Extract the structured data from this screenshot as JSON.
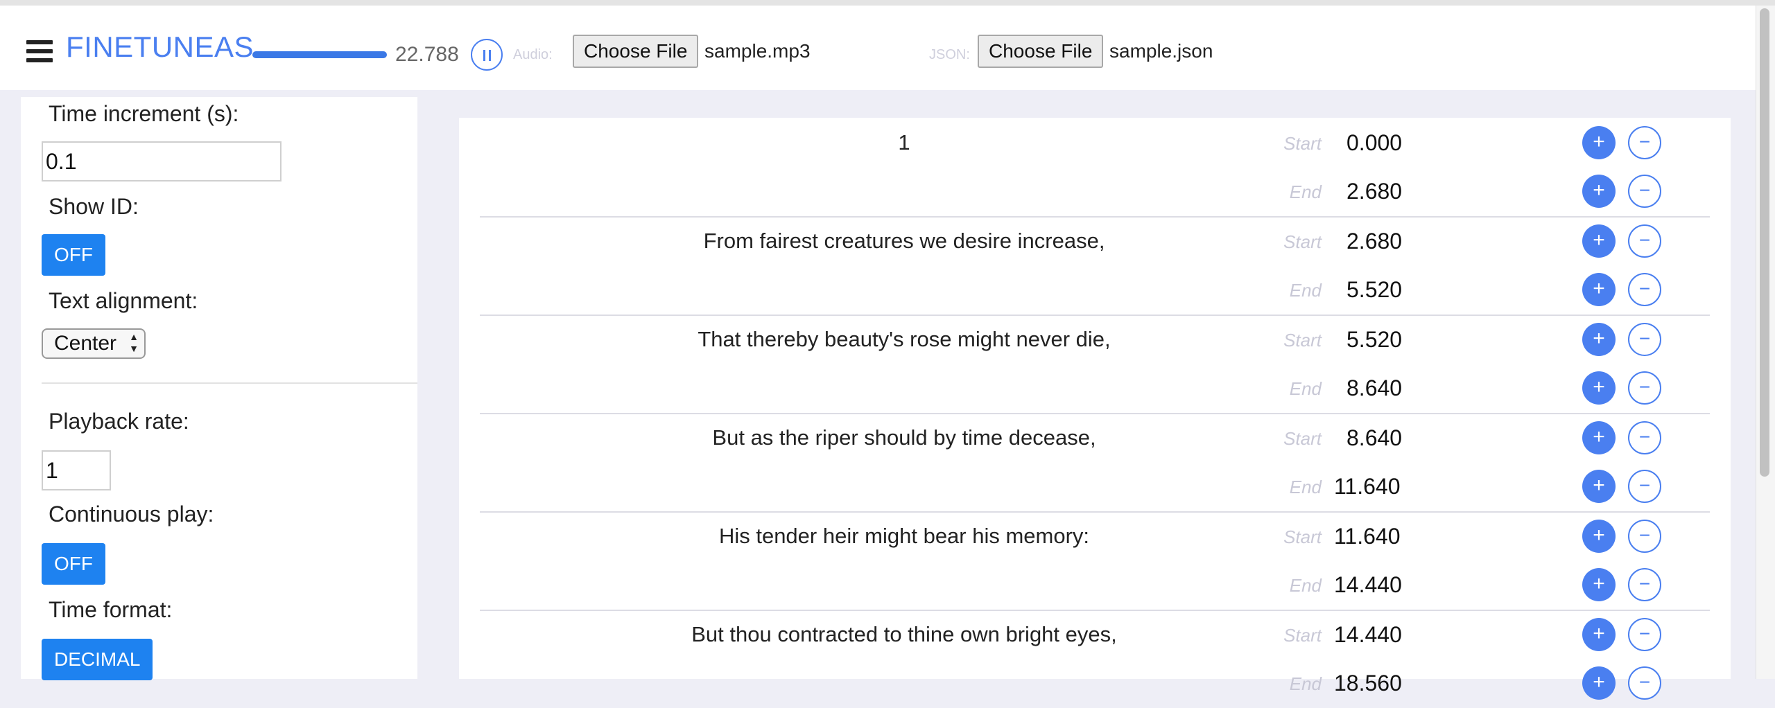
{
  "header": {
    "logo": "FINETUNEAS",
    "time_readout": "22.788",
    "playback_progress": 0.88,
    "audio_label": "Audio:",
    "audio_button": "Choose File",
    "audio_file": "sample.mp3",
    "json_label": "JSON:",
    "json_button": "Choose File",
    "json_file": "sample.json"
  },
  "sidebar": {
    "time_increment_label": "Time increment (s):",
    "time_increment_value": "0.1",
    "show_id_label": "Show ID:",
    "show_id_value": "OFF",
    "text_alignment_label": "Text alignment:",
    "text_alignment_value": "Center",
    "playback_rate_label": "Playback rate:",
    "playback_rate_value": "1",
    "continuous_play_label": "Continuous play:",
    "continuous_play_value": "OFF",
    "time_format_label": "Time format:",
    "time_format_value": "DECIMAL"
  },
  "fragments": [
    {
      "text": "1",
      "start_label": "Start",
      "start": "0.000",
      "end_label": "End",
      "end": "2.680"
    },
    {
      "text": "From fairest creatures we desire increase,",
      "start_label": "Start",
      "start": "2.680",
      "end_label": "End",
      "end": "5.520"
    },
    {
      "text": "That thereby beauty's rose might never die,",
      "start_label": "Start",
      "start": "5.520",
      "end_label": "End",
      "end": "8.640"
    },
    {
      "text": "But as the riper should by time decease,",
      "start_label": "Start",
      "start": "8.640",
      "end_label": "End",
      "end": "11.640"
    },
    {
      "text": "His tender heir might bear his memory:",
      "start_label": "Start",
      "start": "11.640",
      "end_label": "End",
      "end": "14.440"
    },
    {
      "text": "But thou contracted to thine own bright eyes,",
      "start_label": "Start",
      "start": "14.440",
      "end_label": "End",
      "end": "18.560"
    }
  ],
  "icons": {
    "plus": "+",
    "minus": "−",
    "menu": "hamburger-icon",
    "pause": "pause-icon"
  },
  "colors": {
    "accent": "#4a7ff0",
    "toggle": "#1e82f0"
  }
}
